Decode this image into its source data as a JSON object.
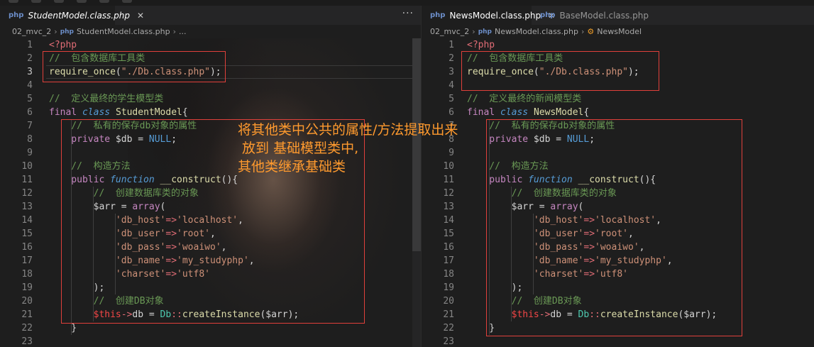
{
  "annotation": {
    "lines": [
      "将其他类中公共的属性/方法提取出来",
      " 放到 基础模型类中,",
      "其他类继承基础类"
    ]
  },
  "left_pane": {
    "tabs": [
      {
        "label": "StudentModel.class.php",
        "close": "✕",
        "active": true,
        "italic": true
      }
    ],
    "more": "···",
    "breadcrumb": {
      "folder": "02_mvc_2",
      "file": "StudentModel.class.php",
      "tail": "..."
    },
    "current_line": 3
  },
  "right_pane": {
    "tabs": [
      {
        "label": "NewsModel.class.php",
        "close": "✕",
        "active": true,
        "italic": false
      },
      {
        "label": "BaseModel.class.php",
        "close": "",
        "active": false,
        "italic": false
      }
    ],
    "breadcrumb": {
      "folder": "02_mvc_2",
      "file": "NewsModel.class.php",
      "tail": "NewsModel"
    }
  },
  "code_left": [
    {
      "n": "1",
      "tokens": [
        {
          "t": "<?php",
          "c": "tag"
        }
      ]
    },
    {
      "n": "2",
      "tokens": [
        {
          "t": "//  包含数据库工具类",
          "c": "com"
        }
      ]
    },
    {
      "n": "3",
      "tokens": [
        {
          "t": "require_once",
          "c": "fn"
        },
        {
          "t": "(",
          "c": "pl"
        },
        {
          "t": "\"./Db.class.php\"",
          "c": "str"
        },
        {
          "t": ");",
          "c": "pl"
        }
      ]
    },
    {
      "n": "4",
      "tokens": []
    },
    {
      "n": "5",
      "tokens": [
        {
          "t": "//  定义最终的学生模型类",
          "c": "com"
        }
      ]
    },
    {
      "n": "6",
      "tokens": [
        {
          "t": "final ",
          "c": "kw2"
        },
        {
          "t": "class ",
          "c": "kw"
        },
        {
          "t": "StudentModel",
          "c": "fn"
        },
        {
          "t": "{",
          "c": "pl"
        }
      ]
    },
    {
      "n": "7",
      "tokens": [
        {
          "t": "    //  私有的保存db对象的属性",
          "c": "com"
        }
      ]
    },
    {
      "n": "8",
      "tokens": [
        {
          "t": "    private ",
          "c": "kw2"
        },
        {
          "t": "$db",
          "c": "pl"
        },
        {
          "t": " = ",
          "c": "op"
        },
        {
          "t": "NULL",
          "c": "const"
        },
        {
          "t": ";",
          "c": "pl"
        }
      ]
    },
    {
      "n": "9",
      "tokens": []
    },
    {
      "n": "10",
      "tokens": [
        {
          "t": "    //  构造方法",
          "c": "com"
        }
      ]
    },
    {
      "n": "11",
      "tokens": [
        {
          "t": "    public ",
          "c": "kw2"
        },
        {
          "t": "function ",
          "c": "kw"
        },
        {
          "t": "__construct",
          "c": "fn"
        },
        {
          "t": "(){",
          "c": "pl"
        }
      ]
    },
    {
      "n": "12",
      "tokens": [
        {
          "t": "        //  创建数据库类的对象",
          "c": "com"
        }
      ]
    },
    {
      "n": "13",
      "tokens": [
        {
          "t": "        $arr",
          "c": "pl"
        },
        {
          "t": " = ",
          "c": "op"
        },
        {
          "t": "array",
          "c": "kw2"
        },
        {
          "t": "(",
          "c": "pl"
        }
      ]
    },
    {
      "n": "14",
      "tokens": [
        {
          "t": "            'db_host'",
          "c": "str"
        },
        {
          "t": "=>",
          "c": "tag"
        },
        {
          "t": "'localhost'",
          "c": "str"
        },
        {
          "t": ",",
          "c": "pl"
        }
      ]
    },
    {
      "n": "15",
      "tokens": [
        {
          "t": "            'db_user'",
          "c": "str"
        },
        {
          "t": "=>",
          "c": "tag"
        },
        {
          "t": "'root'",
          "c": "str"
        },
        {
          "t": ",",
          "c": "pl"
        }
      ]
    },
    {
      "n": "16",
      "tokens": [
        {
          "t": "            'db_pass'",
          "c": "str"
        },
        {
          "t": "=>",
          "c": "tag"
        },
        {
          "t": "'woaiwo'",
          "c": "str"
        },
        {
          "t": ",",
          "c": "pl"
        }
      ]
    },
    {
      "n": "17",
      "tokens": [
        {
          "t": "            'db_name'",
          "c": "str"
        },
        {
          "t": "=>",
          "c": "tag"
        },
        {
          "t": "'my_studyphp'",
          "c": "str"
        },
        {
          "t": ",",
          "c": "pl"
        }
      ]
    },
    {
      "n": "18",
      "tokens": [
        {
          "t": "            'charset'",
          "c": "str"
        },
        {
          "t": "=>",
          "c": "tag"
        },
        {
          "t": "'utf8'",
          "c": "str"
        }
      ]
    },
    {
      "n": "19",
      "tokens": [
        {
          "t": "        );",
          "c": "pl"
        }
      ]
    },
    {
      "n": "20",
      "tokens": [
        {
          "t": "        //  创建DB对象",
          "c": "com"
        }
      ]
    },
    {
      "n": "21",
      "tokens": [
        {
          "t": "        $this",
          "c": "this"
        },
        {
          "t": "->",
          "c": "tag"
        },
        {
          "t": "db",
          "c": "pl"
        },
        {
          "t": " = ",
          "c": "op"
        },
        {
          "t": "Db",
          "c": "cls"
        },
        {
          "t": "::",
          "c": "tag"
        },
        {
          "t": "createInstance",
          "c": "fn"
        },
        {
          "t": "(",
          "c": "pl"
        },
        {
          "t": "$arr",
          "c": "pl"
        },
        {
          "t": ");",
          "c": "pl"
        }
      ]
    },
    {
      "n": "22",
      "tokens": [
        {
          "t": "    }",
          "c": "pl"
        }
      ]
    },
    {
      "n": "23",
      "tokens": []
    }
  ],
  "code_right": [
    {
      "n": "1",
      "tokens": [
        {
          "t": "<?php",
          "c": "tag"
        }
      ]
    },
    {
      "n": "2",
      "tokens": [
        {
          "t": "//  包含数据库工具类",
          "c": "com"
        }
      ]
    },
    {
      "n": "3",
      "tokens": [
        {
          "t": "require_once",
          "c": "fn"
        },
        {
          "t": "(",
          "c": "pl"
        },
        {
          "t": "\"./Db.class.php\"",
          "c": "str"
        },
        {
          "t": ");",
          "c": "pl"
        }
      ]
    },
    {
      "n": "4",
      "tokens": []
    },
    {
      "n": "5",
      "tokens": [
        {
          "t": "//  定义最终的新闻模型类",
          "c": "com"
        }
      ]
    },
    {
      "n": "6",
      "tokens": [
        {
          "t": "final ",
          "c": "kw2"
        },
        {
          "t": "class ",
          "c": "kw"
        },
        {
          "t": "NewsModel",
          "c": "fn"
        },
        {
          "t": "{",
          "c": "pl"
        }
      ]
    },
    {
      "n": "7",
      "tokens": [
        {
          "t": "    //  私有的保存db对象的属性",
          "c": "com"
        }
      ]
    },
    {
      "n": "8",
      "tokens": [
        {
          "t": "    private ",
          "c": "kw2"
        },
        {
          "t": "$db",
          "c": "pl"
        },
        {
          "t": " = ",
          "c": "op"
        },
        {
          "t": "NULL",
          "c": "const"
        },
        {
          "t": ";",
          "c": "pl"
        }
      ]
    },
    {
      "n": "9",
      "tokens": []
    },
    {
      "n": "10",
      "tokens": [
        {
          "t": "    //  构造方法",
          "c": "com"
        }
      ]
    },
    {
      "n": "11",
      "tokens": [
        {
          "t": "    public ",
          "c": "kw2"
        },
        {
          "t": "function ",
          "c": "kw"
        },
        {
          "t": "__construct",
          "c": "fn"
        },
        {
          "t": "(){",
          "c": "pl"
        }
      ]
    },
    {
      "n": "12",
      "tokens": [
        {
          "t": "        //  创建数据库类的对象",
          "c": "com"
        }
      ]
    },
    {
      "n": "13",
      "tokens": [
        {
          "t": "        $arr",
          "c": "pl"
        },
        {
          "t": " = ",
          "c": "op"
        },
        {
          "t": "array",
          "c": "kw2"
        },
        {
          "t": "(",
          "c": "pl"
        }
      ]
    },
    {
      "n": "14",
      "tokens": [
        {
          "t": "            'db_host'",
          "c": "str"
        },
        {
          "t": "=>",
          "c": "tag"
        },
        {
          "t": "'localhost'",
          "c": "str"
        },
        {
          "t": ",",
          "c": "pl"
        }
      ]
    },
    {
      "n": "15",
      "tokens": [
        {
          "t": "            'db_user'",
          "c": "str"
        },
        {
          "t": "=>",
          "c": "tag"
        },
        {
          "t": "'root'",
          "c": "str"
        },
        {
          "t": ",",
          "c": "pl"
        }
      ]
    },
    {
      "n": "16",
      "tokens": [
        {
          "t": "            'db_pass'",
          "c": "str"
        },
        {
          "t": "=>",
          "c": "tag"
        },
        {
          "t": "'woaiwo'",
          "c": "str"
        },
        {
          "t": ",",
          "c": "pl"
        }
      ]
    },
    {
      "n": "17",
      "tokens": [
        {
          "t": "            'db_name'",
          "c": "str"
        },
        {
          "t": "=>",
          "c": "tag"
        },
        {
          "t": "'my_studyphp'",
          "c": "str"
        },
        {
          "t": ",",
          "c": "pl"
        }
      ]
    },
    {
      "n": "18",
      "tokens": [
        {
          "t": "            'charset'",
          "c": "str"
        },
        {
          "t": "=>",
          "c": "tag"
        },
        {
          "t": "'utf8'",
          "c": "str"
        }
      ]
    },
    {
      "n": "19",
      "tokens": [
        {
          "t": "        );",
          "c": "pl"
        }
      ]
    },
    {
      "n": "20",
      "tokens": [
        {
          "t": "        //  创建DB对象",
          "c": "com"
        }
      ]
    },
    {
      "n": "21",
      "tokens": [
        {
          "t": "        $this",
          "c": "this"
        },
        {
          "t": "->",
          "c": "tag"
        },
        {
          "t": "db",
          "c": "pl"
        },
        {
          "t": " = ",
          "c": "op"
        },
        {
          "t": "Db",
          "c": "cls"
        },
        {
          "t": "::",
          "c": "tag"
        },
        {
          "t": "createInstance",
          "c": "fn"
        },
        {
          "t": "(",
          "c": "pl"
        },
        {
          "t": "$arr",
          "c": "pl"
        },
        {
          "t": ");",
          "c": "pl"
        }
      ]
    },
    {
      "n": "22",
      "tokens": [
        {
          "t": "    }",
          "c": "pl"
        }
      ]
    },
    {
      "n": "23",
      "tokens": []
    }
  ]
}
